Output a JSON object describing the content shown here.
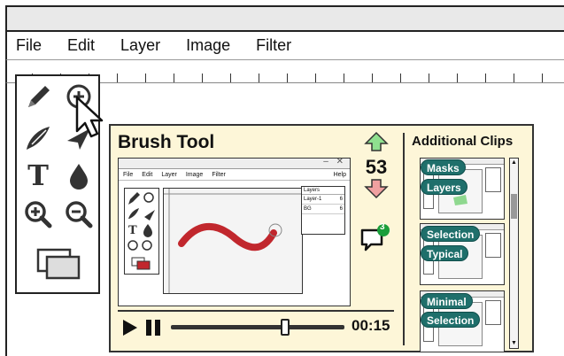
{
  "menu": [
    "File",
    "Edit",
    "Layer",
    "Image",
    "Filter"
  ],
  "toolbox": {
    "tools": [
      "pencil-icon",
      "zoom-circle-icon",
      "brush-icon",
      "arrow-pen-icon",
      "text-icon",
      "ink-drop-icon",
      "zoom-in-icon",
      "zoom-out-icon",
      "layers-icon"
    ],
    "text_tool_label": "T"
  },
  "card": {
    "title": "Brush Tool",
    "vote_count": "53",
    "comment_badge": "3",
    "player": {
      "time": "00:15",
      "progress": 0.66
    },
    "mini_app": {
      "window_controls": "– ✕",
      "menu": [
        "File",
        "Edit",
        "Layer",
        "Image",
        "Filter"
      ],
      "help": "Help",
      "layers_header": "Layers",
      "layers": [
        {
          "name": "Layer-1",
          "value": "6"
        },
        {
          "name": "BG",
          "value": "6"
        }
      ],
      "text_tool_label": "T"
    },
    "clips": {
      "title": "Additional Clips",
      "items": [
        {
          "tags": [
            "Masks",
            "Layers"
          ]
        },
        {
          "tags": [
            "Selection",
            "Typical"
          ]
        },
        {
          "tags": [
            "Minimal",
            "Selection"
          ]
        }
      ],
      "scroll_up": "▲",
      "scroll_down": "▼"
    }
  },
  "colors": {
    "card_bg": "#fdf6d8",
    "tag": "#1f6f6b",
    "up_arrow": "#8fe08f",
    "down_arrow": "#f0a0a0",
    "stroke": "#c1272d",
    "badge": "#1a9e3a"
  }
}
